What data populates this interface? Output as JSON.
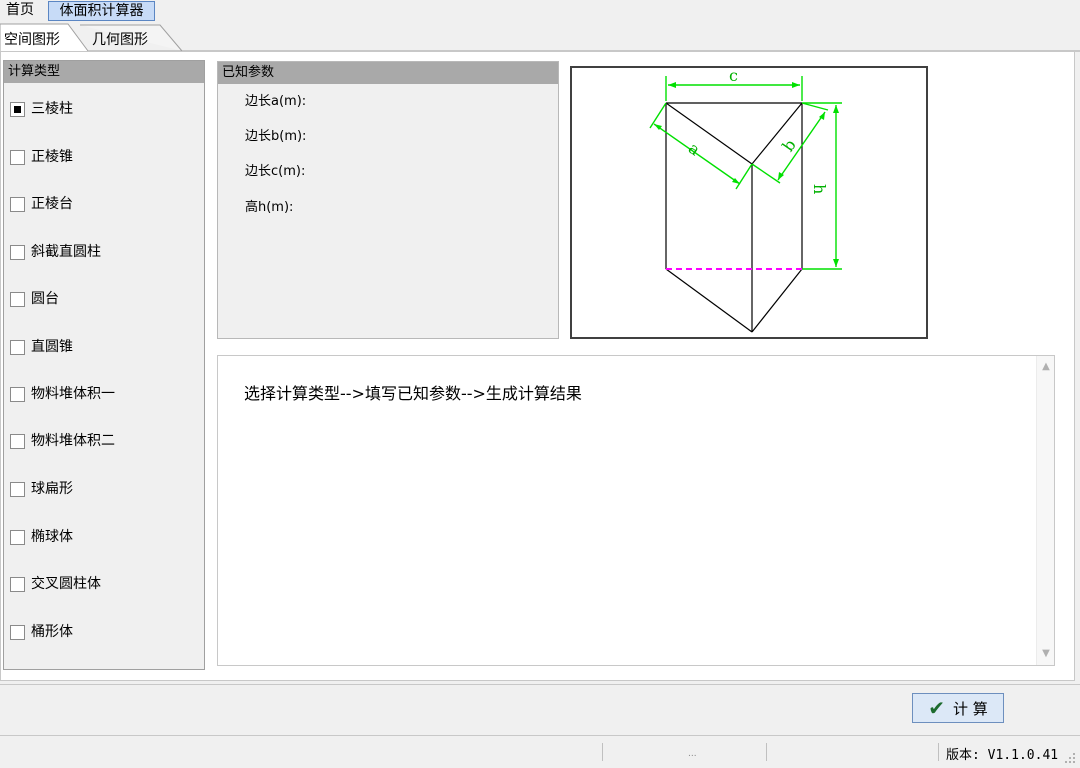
{
  "menu": {
    "home": "首页",
    "calculator": "体面积计算器"
  },
  "subtabs": {
    "space": "空间图形",
    "geometry": "几何图形"
  },
  "type_panel": {
    "title": "计算类型",
    "items": [
      "三棱柱",
      "正棱锥",
      "正棱台",
      "斜截直圆柱",
      "圆台",
      "直圆锥",
      "物料堆体积一",
      "物料堆体积二",
      "球扁形",
      "椭球体",
      "交叉圆柱体",
      "桶形体"
    ],
    "selected": "三棱柱"
  },
  "params": {
    "title": "已知参数",
    "labels": [
      "边长a(m):",
      "边长b(m):",
      "边长c(m):",
      "高h(m):"
    ]
  },
  "diagram": {
    "label_a": "a",
    "label_b": "b",
    "label_c": "c",
    "label_h": "h",
    "dim_color": "#00e000",
    "dash_color": "#ff00ff"
  },
  "result": {
    "hint": "选择计算类型-->填写已知参数-->生成计算结果"
  },
  "actions": {
    "calc_label": "计 算"
  },
  "status": {
    "version": "版本: V1.1.0.41",
    "dots": "..."
  }
}
